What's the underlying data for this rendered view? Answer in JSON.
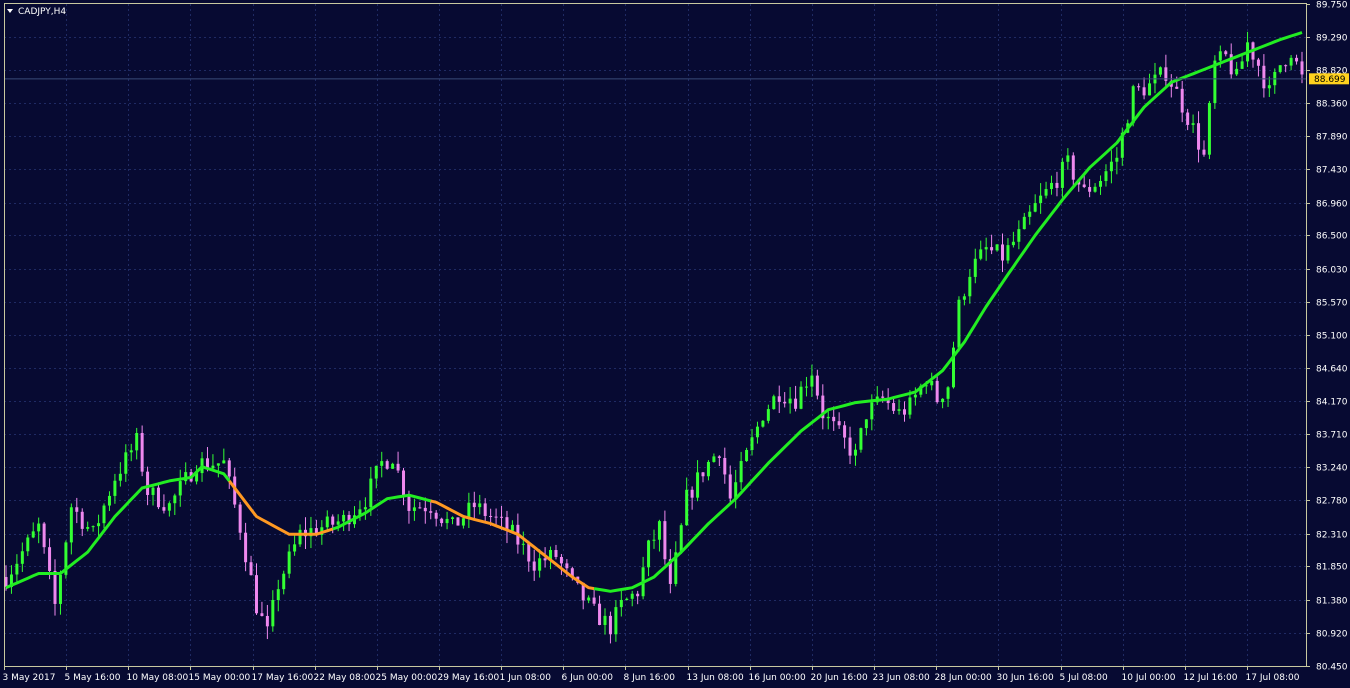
{
  "symbol": "CADJPY,H4",
  "colors": {
    "background": "#070a32",
    "frame": "#c8c8a0",
    "grid": "#1f2a63",
    "axis_text": "#ffffff",
    "bull_candle": "#33ff33",
    "bear_candle": "#ee88ee",
    "ma_up": "#22ee22",
    "ma_down": "#ff9922",
    "current_price_bg": "#ffd21e"
  },
  "chart_data": {
    "type": "candlestick",
    "title": "CADJPY,H4",
    "current_price": 88.699,
    "current_price_label": "88.699",
    "y_ticks": [
      "89.750",
      "89.290",
      "88.820",
      "88.360",
      "87.890",
      "87.430",
      "86.960",
      "86.500",
      "86.030",
      "85.570",
      "85.100",
      "84.640",
      "84.170",
      "83.710",
      "83.240",
      "82.780",
      "82.310",
      "81.850",
      "81.380",
      "80.920",
      "80.450"
    ],
    "ylim": [
      80.45,
      89.75
    ],
    "x_ticks": [
      "3 May 2017",
      "5 May 16:00",
      "10 May 08:00",
      "15 May 00:00",
      "17 May 16:00",
      "22 May 08:00",
      "25 May 00:00",
      "29 May 16:00",
      "1 Jun 08:00",
      "6 Jun 00:00",
      "8 Jun 16:00",
      "13 Jun 08:00",
      "16 Jun 00:00",
      "20 Jun 16:00",
      "23 Jun 08:00",
      "28 Jun 00:00",
      "30 Jun 16:00",
      "5 Jul 08:00",
      "10 Jul 00:00",
      "12 Jul 16:00",
      "17 Jul 08:00"
    ],
    "price_path": [
      [
        0,
        81.7
      ],
      [
        6,
        82.4
      ],
      [
        9,
        81.3
      ],
      [
        12,
        82.7
      ],
      [
        16,
        82.3
      ],
      [
        20,
        83.1
      ],
      [
        24,
        83.6
      ],
      [
        26,
        82.9
      ],
      [
        30,
        82.7
      ],
      [
        35,
        83.3
      ],
      [
        40,
        83.3
      ],
      [
        43,
        82.4
      ],
      [
        46,
        81.3
      ],
      [
        48,
        80.9
      ],
      [
        50,
        81.6
      ],
      [
        54,
        82.3
      ],
      [
        58,
        82.4
      ],
      [
        62,
        82.5
      ],
      [
        66,
        82.8
      ],
      [
        69,
        83.3
      ],
      [
        71,
        83.4
      ],
      [
        74,
        82.7
      ],
      [
        78,
        82.7
      ],
      [
        82,
        82.4
      ],
      [
        86,
        82.7
      ],
      [
        90,
        82.5
      ],
      [
        93,
        82.3
      ],
      [
        97,
        81.9
      ],
      [
        101,
        82.0
      ],
      [
        104,
        81.6
      ],
      [
        108,
        81.2
      ],
      [
        111,
        81.0
      ],
      [
        113,
        81.3
      ],
      [
        116,
        81.5
      ],
      [
        118,
        82.1
      ],
      [
        120,
        82.4
      ],
      [
        122,
        81.5
      ],
      [
        125,
        82.8
      ],
      [
        128,
        83.2
      ],
      [
        131,
        83.5
      ],
      [
        133,
        82.8
      ],
      [
        136,
        83.4
      ],
      [
        139,
        84.0
      ],
      [
        142,
        84.3
      ],
      [
        145,
        84.2
      ],
      [
        148,
        84.6
      ],
      [
        150,
        84.0
      ],
      [
        153,
        83.7
      ],
      [
        156,
        83.4
      ],
      [
        158,
        84.0
      ],
      [
        161,
        84.2
      ],
      [
        164,
        84.0
      ],
      [
        166,
        84.1
      ],
      [
        169,
        84.5
      ],
      [
        171,
        84.2
      ],
      [
        173,
        84.4
      ],
      [
        175,
        85.5
      ],
      [
        177,
        86.0
      ],
      [
        180,
        86.3
      ],
      [
        183,
        86.2
      ],
      [
        186,
        86.5
      ],
      [
        189,
        86.9
      ],
      [
        192,
        87.2
      ],
      [
        195,
        87.5
      ],
      [
        198,
        87.1
      ],
      [
        201,
        87.3
      ],
      [
        204,
        87.6
      ],
      [
        207,
        88.5
      ],
      [
        210,
        88.6
      ],
      [
        213,
        88.8
      ],
      [
        215,
        88.5
      ],
      [
        218,
        88.0
      ],
      [
        220,
        87.6
      ],
      [
        222,
        88.9
      ],
      [
        224,
        89.0
      ],
      [
        226,
        88.7
      ],
      [
        228,
        89.2
      ],
      [
        230,
        88.9
      ],
      [
        232,
        88.5
      ],
      [
        234,
        88.9
      ],
      [
        236,
        89.1
      ],
      [
        238,
        88.7
      ]
    ],
    "ma_path": [
      [
        0,
        81.55
      ],
      [
        6,
        81.75
      ],
      [
        10,
        81.75
      ],
      [
        15,
        82.05
      ],
      [
        20,
        82.55
      ],
      [
        25,
        82.95
      ],
      [
        30,
        83.05
      ],
      [
        34,
        83.1
      ],
      [
        36,
        83.25
      ],
      [
        40,
        83.15
      ],
      [
        46,
        82.55
      ],
      [
        52,
        82.3
      ],
      [
        57,
        82.3
      ],
      [
        61,
        82.4
      ],
      [
        66,
        82.6
      ],
      [
        70,
        82.8
      ],
      [
        74,
        82.85
      ],
      [
        79,
        82.75
      ],
      [
        84,
        82.55
      ],
      [
        89,
        82.45
      ],
      [
        94,
        82.3
      ],
      [
        99,
        82.0
      ],
      [
        104,
        81.7
      ],
      [
        107,
        81.55
      ],
      [
        111,
        81.5
      ],
      [
        115,
        81.55
      ],
      [
        119,
        81.7
      ],
      [
        124,
        82.05
      ],
      [
        129,
        82.45
      ],
      [
        134,
        82.8
      ],
      [
        140,
        83.3
      ],
      [
        146,
        83.75
      ],
      [
        151,
        84.05
      ],
      [
        156,
        84.15
      ],
      [
        162,
        84.2
      ],
      [
        167,
        84.3
      ],
      [
        172,
        84.6
      ],
      [
        176,
        85.0
      ],
      [
        180,
        85.5
      ],
      [
        184,
        85.95
      ],
      [
        189,
        86.5
      ],
      [
        194,
        87.0
      ],
      [
        199,
        87.45
      ],
      [
        204,
        87.8
      ],
      [
        209,
        88.3
      ],
      [
        214,
        88.65
      ],
      [
        219,
        88.8
      ],
      [
        224,
        88.95
      ],
      [
        229,
        89.1
      ],
      [
        234,
        89.25
      ],
      [
        238,
        89.35
      ]
    ],
    "ma_down_ranges": [
      [
        41,
        60
      ],
      [
        78,
        108
      ]
    ]
  }
}
